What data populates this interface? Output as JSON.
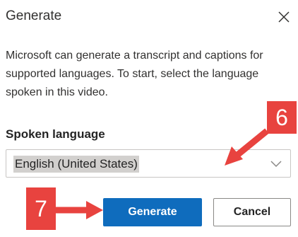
{
  "dialog": {
    "title": "Generate",
    "close_icon": "close-icon",
    "description": "Microsoft can generate a transcript and captions for supported languages. To start, select the language spoken in this video.",
    "spoken_language": {
      "label": "Spoken language",
      "selected_value": "English (United States)",
      "dropdown_icon": "chevron-down-icon"
    },
    "buttons": {
      "generate_label": "Generate",
      "cancel_label": "Cancel"
    },
    "annotations": {
      "step_6": "6",
      "step_7": "7",
      "color": "#e8433f"
    },
    "colors": {
      "primary": "#0f6cbd",
      "selection_highlight": "#d2d0ce"
    }
  }
}
